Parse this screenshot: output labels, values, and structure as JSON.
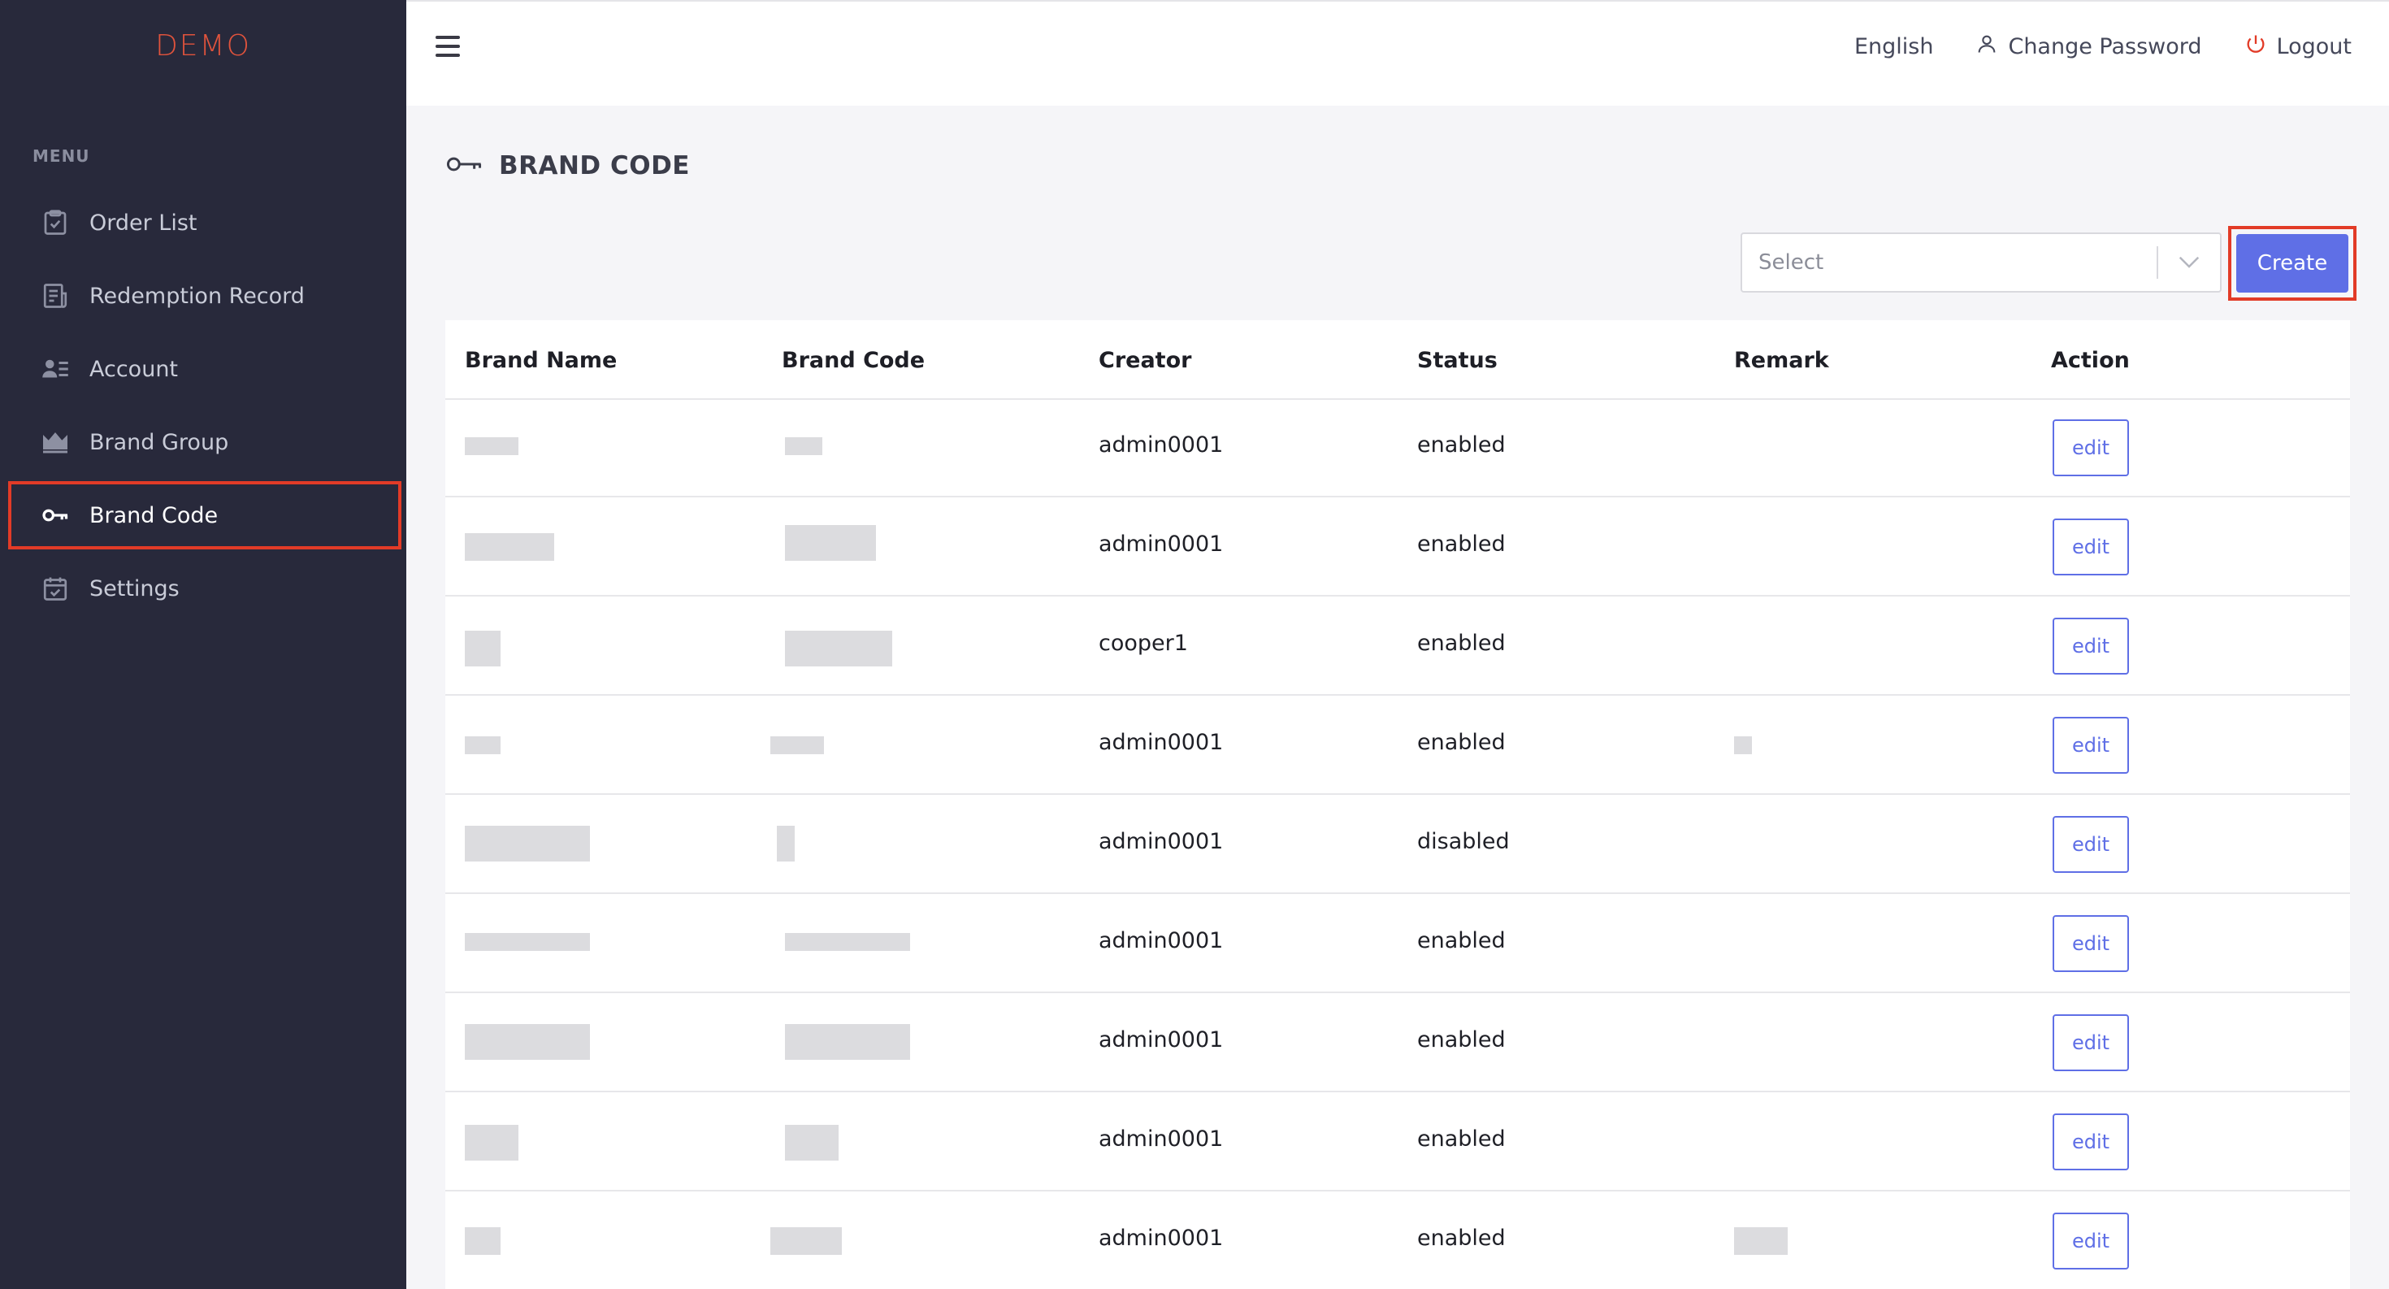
{
  "sidebar": {
    "brand": "DEMO",
    "brand_color": "#e0533c",
    "menu_label": "MENU",
    "items": [
      {
        "label": "Order List",
        "icon": "clipboard-check-icon"
      },
      {
        "label": "Redemption Record",
        "icon": "receipt-icon"
      },
      {
        "label": "Account",
        "icon": "user-list-icon"
      },
      {
        "label": "Brand Group",
        "icon": "crown-icon"
      },
      {
        "label": "Brand Code",
        "icon": "key-icon",
        "active": true
      },
      {
        "label": "Settings",
        "icon": "calendar-check-icon"
      }
    ]
  },
  "header": {
    "language": "English",
    "change_password": "Change Password",
    "logout": "Logout"
  },
  "page": {
    "title": "BRAND CODE",
    "filter_placeholder": "Select",
    "create_label": "Create",
    "accent_color": "#5f6fe6",
    "highlight_color": "#e23b27"
  },
  "table": {
    "columns": [
      "Brand Name",
      "Brand Code",
      "Creator",
      "Status",
      "Remark",
      "Action"
    ],
    "rows": [
      {
        "creator": "admin0001",
        "status": "enabled",
        "action": "edit"
      },
      {
        "creator": "admin0001",
        "status": "enabled",
        "action": "edit"
      },
      {
        "creator": "cooper1",
        "status": "enabled",
        "action": "edit"
      },
      {
        "creator": "admin0001",
        "status": "enabled",
        "action": "edit"
      },
      {
        "creator": "admin0001",
        "status": "disabled",
        "action": "edit"
      },
      {
        "creator": "admin0001",
        "status": "enabled",
        "action": "edit"
      },
      {
        "creator": "admin0001",
        "status": "enabled",
        "action": "edit"
      },
      {
        "creator": "admin0001",
        "status": "enabled",
        "action": "edit"
      },
      {
        "creator": "admin0001",
        "status": "enabled",
        "action": "edit"
      }
    ]
  }
}
